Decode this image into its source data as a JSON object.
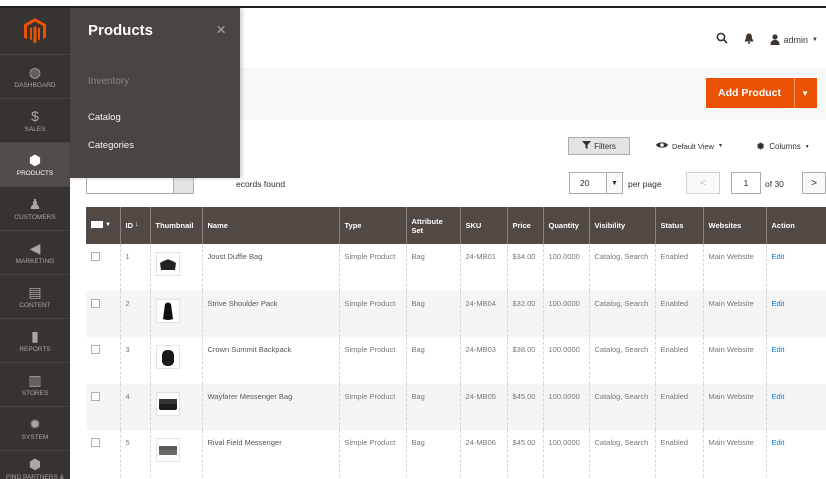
{
  "sidebar": {
    "items": [
      {
        "label": "DASHBOARD",
        "icon": "dashboard-icon",
        "glyph": "◍"
      },
      {
        "label": "SALES",
        "icon": "dollar-icon",
        "glyph": "$"
      },
      {
        "label": "PRODUCTS",
        "icon": "cube-icon",
        "glyph": "⬢"
      },
      {
        "label": "CUSTOMERS",
        "icon": "person-icon",
        "glyph": "♟"
      },
      {
        "label": "MARKETING",
        "icon": "megaphone-icon",
        "glyph": "◀"
      },
      {
        "label": "CONTENT",
        "icon": "content-icon",
        "glyph": "▤"
      },
      {
        "label": "REPORTS",
        "icon": "bar-chart-icon",
        "glyph": "▮"
      },
      {
        "label": "STORES",
        "icon": "store-icon",
        "glyph": "▥"
      },
      {
        "label": "SYSTEM",
        "icon": "gear-icon",
        "glyph": "✹"
      },
      {
        "label": "FIND PARTNERS & EXTENSIONS",
        "icon": "cube-icon",
        "glyph": "⬢"
      }
    ]
  },
  "flyout": {
    "title": "Products",
    "close": "×",
    "section": "Inventory",
    "links": [
      "Catalog",
      "Categories"
    ]
  },
  "header": {
    "user": "admin",
    "search_icon": "search-icon",
    "notification_icon": "bell-icon",
    "user_icon": "user-icon"
  },
  "actions": {
    "add_product": "Add Product"
  },
  "toolbar": {
    "filters": "Filters",
    "default_view": "Default View",
    "columns": "Columns",
    "records_found": "ecords found",
    "per_page_value": "20",
    "per_page_label": "per page",
    "page_current": "1",
    "page_of": "of 30"
  },
  "grid": {
    "columns": [
      "",
      "ID",
      "Thumbnail",
      "Name",
      "Type",
      "Attribute Set",
      "SKU",
      "Price",
      "Quantity",
      "Visibility",
      "Status",
      "Websites",
      "Action"
    ],
    "rows": [
      {
        "id": "1",
        "name": "Joust Duffle Bag",
        "type": "Simple Product",
        "set": "Bag",
        "sku": "24-MB01",
        "price": "$34.00",
        "qty": "100.0000",
        "visibility": "Catalog, Search",
        "status": "Enabled",
        "websites": "Main Website",
        "action": "Edit",
        "thumb": "duffle"
      },
      {
        "id": "2",
        "name": "Strive Shoulder Pack",
        "type": "Simple Product",
        "set": "Bag",
        "sku": "24-MB04",
        "price": "$32.00",
        "qty": "100.0000",
        "visibility": "Catalog, Search",
        "status": "Enabled",
        "websites": "Main Website",
        "action": "Edit",
        "thumb": "shoulder"
      },
      {
        "id": "3",
        "name": "Crown Summit Backpack",
        "type": "Simple Product",
        "set": "Bag",
        "sku": "24-MB03",
        "price": "$38.00",
        "qty": "100.0000",
        "visibility": "Catalog, Search",
        "status": "Enabled",
        "websites": "Main Website",
        "action": "Edit",
        "thumb": "backpack"
      },
      {
        "id": "4",
        "name": "Wayfarer Messenger Bag",
        "type": "Simple Product",
        "set": "Bag",
        "sku": "24-MB05",
        "price": "$45.00",
        "qty": "100.0000",
        "visibility": "Catalog, Search",
        "status": "Enabled",
        "websites": "Main Website",
        "action": "Edit",
        "thumb": "messenger"
      },
      {
        "id": "5",
        "name": "Rival Field Messenger",
        "type": "Simple Product",
        "set": "Bag",
        "sku": "24-MB06",
        "price": "$45.00",
        "qty": "100.0000",
        "visibility": "Catalog, Search",
        "status": "Enabled",
        "websites": "Main Website",
        "action": "Edit",
        "thumb": "field"
      }
    ]
  },
  "colors": {
    "sidebar": "#373330",
    "flyout": "#4a4542",
    "accent": "#eb5202",
    "grid_header": "#514943",
    "link": "#007bdb"
  }
}
